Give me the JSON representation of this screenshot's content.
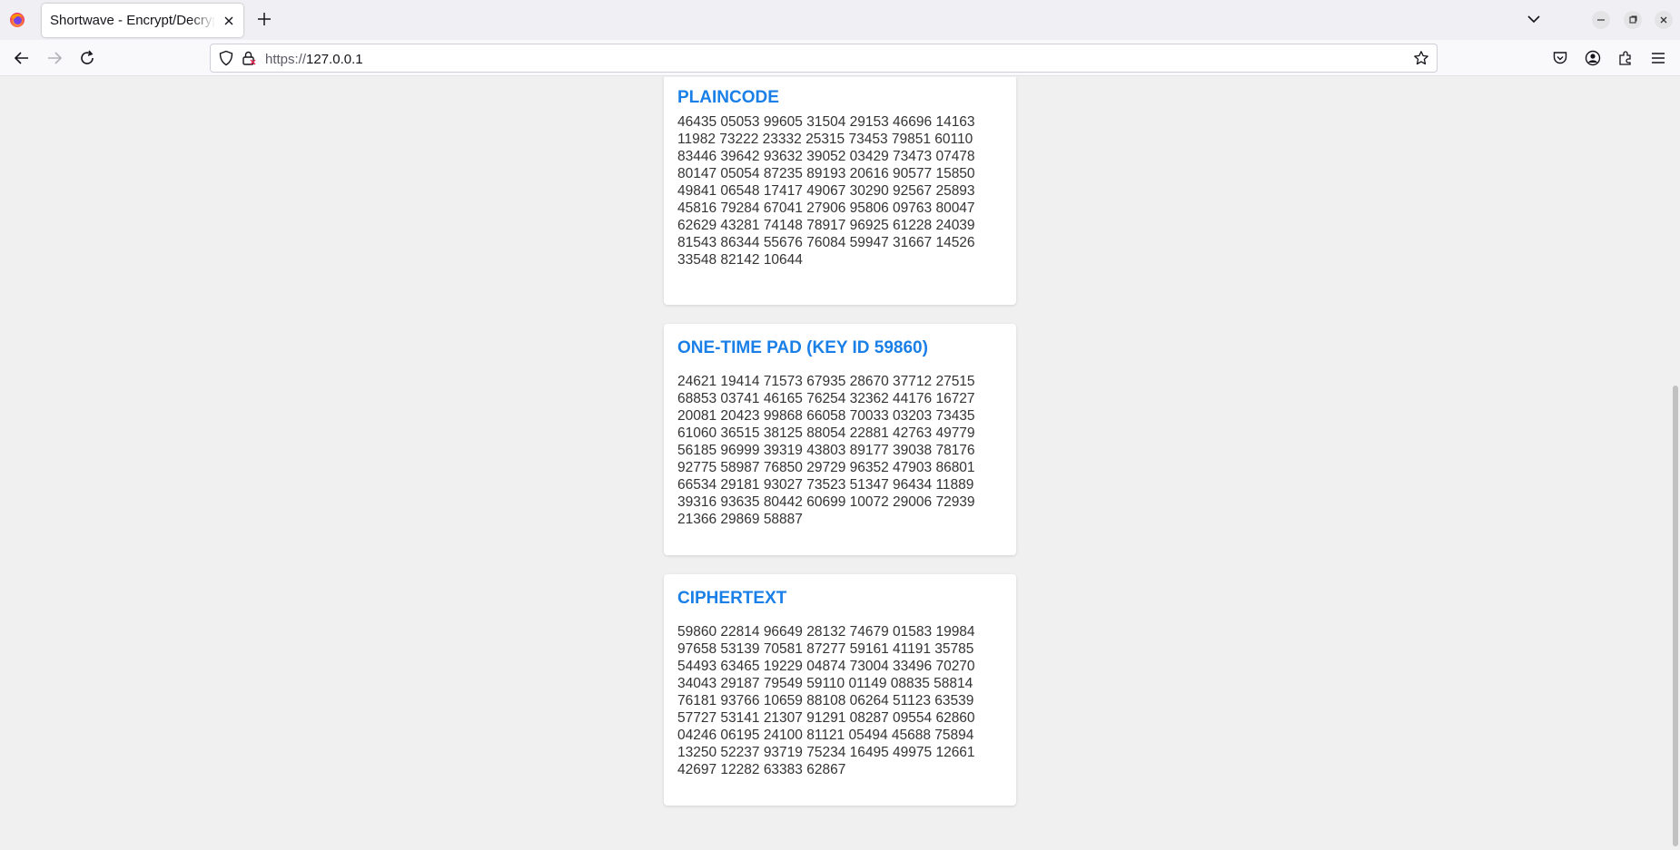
{
  "browser": {
    "tab_title": "Shortwave - Encrypt/Decrypt",
    "url_scheme": "https://",
    "url_host": "127.0.0.1",
    "icons": [
      "firefox-logo-icon",
      "close-icon",
      "plus-icon",
      "chevron-down-icon",
      "minimize-icon",
      "restore-icon",
      "close-icon",
      "back-icon",
      "forward-icon",
      "reload-icon",
      "shield-icon",
      "lock-icon",
      "star-icon",
      "pocket-icon",
      "account-icon",
      "extensions-icon",
      "menu-icon"
    ]
  },
  "colors": {
    "heading": "#1a7fe6",
    "text": "#333333",
    "page_bg": "#f0f0f0",
    "card_bg": "#ffffff"
  },
  "sections": [
    {
      "title": "PLAINCODE",
      "lines": [
        "46435 05053 99605 31504 29153 46696 14163",
        "11982 73222 23332 25315 73453 79851 60110",
        "83446 39642 93632 39052 03429 73473 07478",
        "80147 05054 87235 89193 20616 90577 15850",
        "49841 06548 17417 49067 30290 92567 25893",
        "45816 79284 67041 27906 95806 09763 80047",
        "62629 43281 74148 78917 96925 61228 24039",
        "81543 86344 55676 76084 59947 31667 14526",
        "33548 82142 10644"
      ]
    },
    {
      "title": "ONE-TIME PAD (KEY ID 59860)",
      "lines": [
        "24621 19414 71573 67935 28670 37712 27515",
        "68853 03741 46165 76254 32362 44176 16727",
        "20081 20423 99868 66058 70033 03203 73435",
        "61060 36515 38125 88054 22881 42763 49779",
        "56185 96999 39319 43803 89177 39038 78176",
        "92775 58987 76850 29729 96352 47903 86801",
        "66534 29181 93027 73523 51347 96434 11889",
        "39316 93635 80442 60699 10072 29006 72939",
        "21366 29869 58887"
      ]
    },
    {
      "title": "CIPHERTEXT",
      "lines": [
        "59860 22814 96649 28132 74679 01583 19984",
        "97658 53139 70581 87277 59161 41191 35785",
        "54493 63465 19229 04874 73004 33496 70270",
        "34043 29187 79549 59110 01149 08835 58814",
        "76181 93766 10659 88108 06264 51123 63539",
        "57727 53141 21307 91291 08287 09554 62860",
        "04246 06195 24100 81121 05494 45688 75894",
        "13250 52237 93719 75234 16495 49975 12661",
        "42697 12282 63383 62867"
      ]
    }
  ]
}
